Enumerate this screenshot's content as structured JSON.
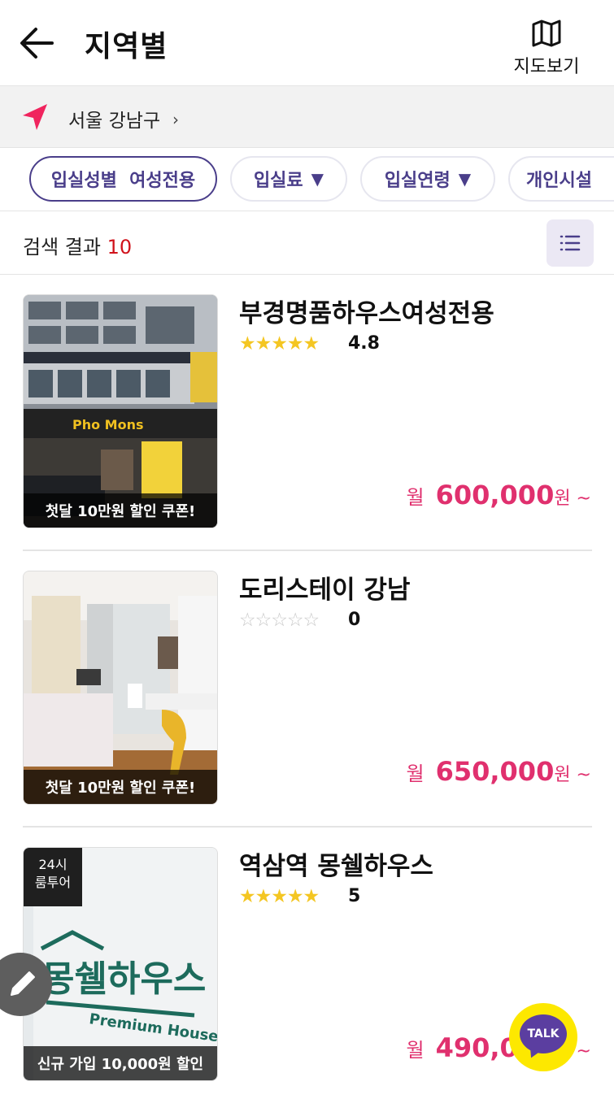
{
  "header": {
    "title": "지역별",
    "back_icon": "arrow-left-icon",
    "map_label": "지도보기",
    "map_icon": "map-icon"
  },
  "location": {
    "icon": "navigation-arrow-icon",
    "text": "서울 강남구",
    "chevron": "›",
    "accent": "#f0245e"
  },
  "filters": [
    {
      "label": "입실성별  여성전용",
      "active": true
    },
    {
      "label": "입실료",
      "has_dropdown": true
    },
    {
      "label": "입실연령",
      "has_dropdown": true
    },
    {
      "label": "개인시설",
      "has_dropdown": true
    }
  ],
  "filter_dropdown_glyph": "▼",
  "results": {
    "label": "검색 결과",
    "count": "10",
    "view_toggle_icon": "list-icon"
  },
  "listings": [
    {
      "name": "부경명품하우스여성전용",
      "stars_filled": 5,
      "stars_total": 5,
      "rating": "4.8",
      "caption": "첫달 10만원 할인 쿠폰!",
      "price_prefix": "월",
      "price": "600,000",
      "price_suffix": "원 ~"
    },
    {
      "name": "도리스테이 강남",
      "stars_filled": 0,
      "stars_total": 5,
      "rating": "0",
      "caption": "첫달 10만원 할인 쿠폰!",
      "price_prefix": "월",
      "price": "650,000",
      "price_suffix": "원 ~"
    },
    {
      "name": "역삼역 몽쉘하우스",
      "stars_filled": 5,
      "stars_total": 5,
      "rating": "5",
      "badge_line1": "24시",
      "badge_line2": "룸투어",
      "caption": "신규 가입 10,000원 할인",
      "price_prefix": "월",
      "price": "490,000",
      "price_suffix": "원 ~"
    }
  ],
  "thumb_signs": {
    "listing_1_shop": "Pho Mons",
    "listing_3_logo": "몽쉘하우스",
    "listing_3_sub": "Premium House"
  },
  "fabs": {
    "edit_icon": "pencil-icon",
    "talk_label": "TALK"
  },
  "colors": {
    "brand_purple": "#4a3e8a",
    "price_pink": "#e0306e",
    "count_red": "#d0121b",
    "star_yellow": "#f4c622",
    "talk_yellow": "#fde800"
  }
}
